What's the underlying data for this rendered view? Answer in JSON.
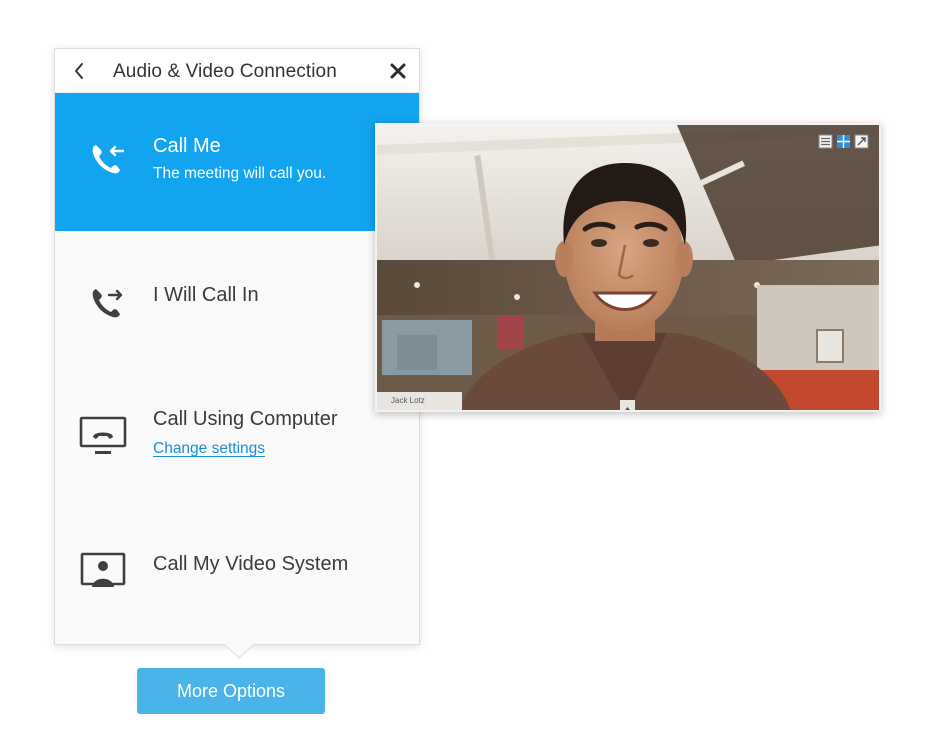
{
  "panel": {
    "title": "Audio & Video Connection",
    "options": [
      {
        "label": "Call Me",
        "sublabel": "The meeting will call you.",
        "icon": "phone-incoming-icon",
        "selected": true
      },
      {
        "label": "I Will Call In",
        "icon": "phone-outgoing-icon",
        "selected": false
      },
      {
        "label": "Call Using Computer",
        "sublabel": "Change settings",
        "icon": "computer-phone-icon",
        "selected": false
      },
      {
        "label": "Call My Video System",
        "icon": "video-system-icon",
        "selected": false
      }
    ]
  },
  "more_options_label": "More Options",
  "video": {
    "participant_name": "Jack Lotz",
    "controls": [
      "list-view-icon",
      "grid-view-icon",
      "fullscreen-icon"
    ]
  },
  "colors": {
    "accent": "#12a4ee",
    "button": "#49b3ea",
    "link": "#1a8fd6",
    "text": "#3b3b3b"
  }
}
